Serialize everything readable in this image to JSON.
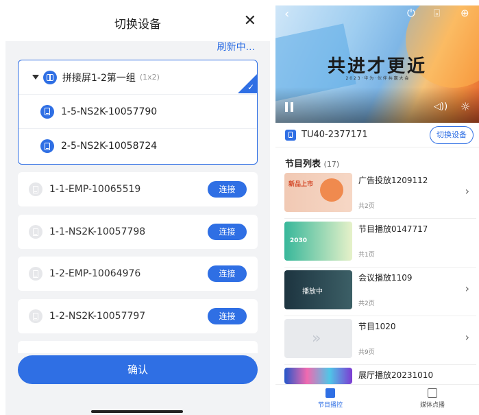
{
  "left": {
    "title": "切换设备",
    "close_icon": "close-icon",
    "refresh": "刷新中...",
    "group": {
      "name": "拼接屏1-2第一组",
      "size": "(1x2)",
      "selected": true,
      "devices": [
        "1-5-NS2K-10057790",
        "2-5-NS2K-10058724"
      ]
    },
    "devices": [
      {
        "name": "1-1-EMP-10065519",
        "action": "连接"
      },
      {
        "name": "1-1-NS2K-10057798",
        "action": "连接"
      },
      {
        "name": "1-2-EMP-10064976",
        "action": "连接"
      },
      {
        "name": "1-2-NS2K-10057797",
        "action": "连接"
      }
    ],
    "confirm": "确认"
  },
  "right": {
    "banner": {
      "title": "共进才更近",
      "subtitle": "2 0 2 3 · 华 为 · 伙 伴 共 赢 大 会"
    },
    "device": {
      "id": "TU40-2377171",
      "switch_label": "切换设备"
    },
    "program_list": {
      "label": "节目列表",
      "count": "(17)"
    },
    "items": [
      {
        "name": "广告投放1209112",
        "pages": "共2页",
        "thumb_text": "新品上市"
      },
      {
        "name": "节目播放0147717",
        "pages": "共1页",
        "thumb_text": "2030"
      },
      {
        "name": "会议播放1109",
        "pages": "共2页",
        "thumb_text": "播放中"
      },
      {
        "name": "节目1020",
        "pages": "共9页",
        "thumb_text": "»"
      },
      {
        "name": "展厅播放20231010",
        "pages": "",
        "thumb_text": ""
      }
    ],
    "tabs": [
      {
        "label": "节目播控",
        "active": true
      },
      {
        "label": "媒体点播",
        "active": false
      }
    ]
  },
  "colors": {
    "accent": "#2f6fe4",
    "bg": "#f2f3f5"
  }
}
